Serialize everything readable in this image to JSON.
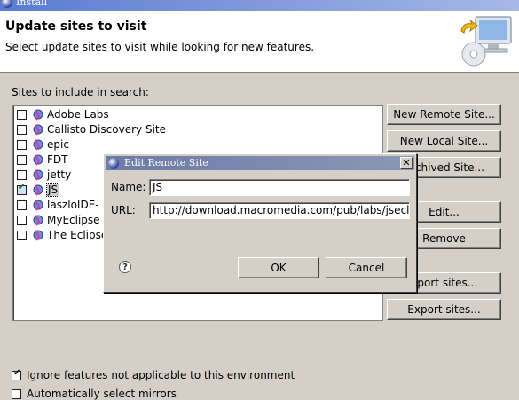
{
  "window": {
    "title": "Install"
  },
  "header": {
    "title": "Update sites to visit",
    "description": "Select update sites to visit while looking for new features."
  },
  "sites_label": "Sites to include in search:",
  "sites": [
    {
      "name": "Adobe Labs",
      "checked": false
    },
    {
      "name": "Callisto Discovery Site",
      "checked": false
    },
    {
      "name": "epic",
      "checked": false
    },
    {
      "name": "FDT",
      "checked": false
    },
    {
      "name": "jetty",
      "checked": false
    },
    {
      "name": "JS",
      "checked": true,
      "selected": true
    },
    {
      "name": "laszloIDE-",
      "checked": false
    },
    {
      "name": "MyEclipse",
      "checked": false
    },
    {
      "name": "The Eclipse",
      "checked": false
    }
  ],
  "buttons": {
    "new_remote": "New Remote Site...",
    "new_local": "New Local Site...",
    "new_archived": "Archived Site...",
    "edit": "Edit...",
    "remove": "Remove",
    "import": "nport sites...",
    "export": "Export sites..."
  },
  "options": {
    "ignore_features": {
      "label": "Ignore features not applicable to this environment",
      "checked": true
    },
    "auto_mirrors": {
      "label": "Automatically select mirrors",
      "checked": false
    }
  },
  "dialog": {
    "title": "Edit Remote Site",
    "name_label": "Name:",
    "name_value": "JS",
    "url_label": "URL:",
    "url_value": "http://download.macromedia.com/pub/labs/jseclipse",
    "ok_label": "OK",
    "cancel_label": "Cancel",
    "close_glyph": "✕",
    "help_glyph": "?"
  },
  "icons": {
    "globe": "update-site-icon",
    "header": "install-wizard-icon"
  }
}
